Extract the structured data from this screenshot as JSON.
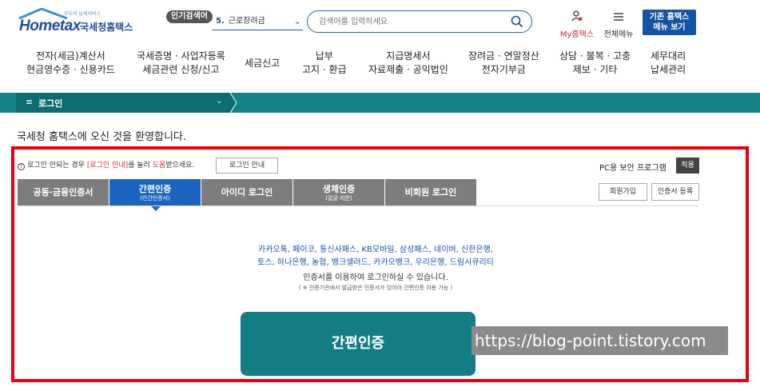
{
  "header": {
    "logo_small": "모두의 납세서비스",
    "logo_main": "Hometax",
    "logo_kor": "국세청홈택스",
    "popular_badge": "인기검색어",
    "popular_number": "5.",
    "popular_term": "근로장려금",
    "search_placeholder": "검색어를 입력하세요",
    "my_hometax": "My홈택스",
    "all_menu": "전체메뉴",
    "old_menu_line1": "기존 홈택스",
    "old_menu_line2": "메뉴 보기"
  },
  "gnb": [
    {
      "line1": "전자(세금)계산서",
      "line2": "현금영수증 · 신용카드"
    },
    {
      "line1": "국세증명 · 사업자등록",
      "line2": "세금관련 신청/신고"
    },
    {
      "line1": "세금신고",
      "line2": ""
    },
    {
      "line1": "납부",
      "line2": "고지 · 환급"
    },
    {
      "line1": "지급명세서",
      "line2": "자료제출 · 공익법인"
    },
    {
      "line1": "장려금 · 연말정산",
      "line2": "전자기부금"
    },
    {
      "line1": "상담 · 불복 · 고충",
      "line2": "제보 · 기타"
    },
    {
      "line1": "세무대리",
      "line2": "납세관리"
    }
  ],
  "breadcrumb": {
    "label": "로그인"
  },
  "welcome": "국세청 홈택스에 오신 것을 환영합니다.",
  "notice": {
    "prefix": "로그인 안되는 경우 ",
    "bracket_open": "[",
    "link": "로그인 안내",
    "bracket_close": "]",
    "middle": "를 눌러 ",
    "red": "도움",
    "suffix": "받으세요."
  },
  "login_guide_button": "로그인 안내",
  "pc_security_label": "PC용 보안 프로그램",
  "apply_button": "적용",
  "tabs": [
    {
      "label": "공동·금융인증서",
      "sub": ""
    },
    {
      "label": "간편인증",
      "sub": "(민간인증서)"
    },
    {
      "label": "아이디 로그인",
      "sub": ""
    },
    {
      "label": "생체인증",
      "sub": "(얼굴·지문)"
    },
    {
      "label": "비회원 로그인",
      "sub": ""
    }
  ],
  "join_button": "회원가입",
  "cert_register_button": "인증서 등록",
  "providers_line1": "카카오톡, 페이코, 통신사패스, KB모바일, 삼성패스, 네이버, 신한은행,",
  "providers_line2": "토스, 하나은행, 농협, 뱅크샐러드, 카카오뱅크, 우리은행, 드림시큐리티",
  "info_line": "인증서를 이용하여 로그인하실 수 있습니다.",
  "info_note": "( ※ 인증기관에서 발급받은 인증서가 있어야 간편인증 이용 가능 )",
  "easy_auth_button": "간편인증",
  "watermark": "https://blog-point.tistory.com",
  "colors": {
    "brand_blue": "#1e4e9c",
    "teal": "#138389",
    "active_tab": "#1b65c0",
    "frame_red": "#e8000f"
  }
}
